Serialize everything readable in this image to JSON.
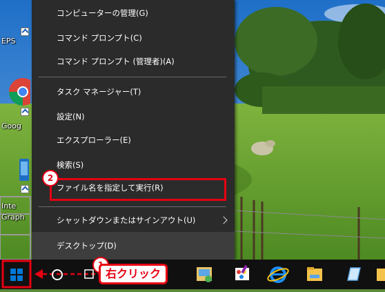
{
  "desktop": {
    "icons": [
      {
        "label": "EPS",
        "icon": "epson-icon"
      },
      {
        "label": "Goog",
        "icon": "google-chrome-icon"
      },
      {
        "label": "Inte",
        "label2": "Graph",
        "icon": "intel-graphics-icon"
      }
    ]
  },
  "menu": {
    "items": [
      {
        "label": "コンピューターの管理(G)"
      },
      {
        "label": "コマンド プロンプト(C)"
      },
      {
        "label": "コマンド プロンプト (管理者)(A)"
      },
      {
        "label": "タスク マネージャー(T)"
      },
      {
        "label": "設定(N)"
      },
      {
        "label": "エクスプローラー(E)"
      },
      {
        "label": "検索(S)"
      },
      {
        "label": "ファイル名を指定して実行(R)"
      },
      {
        "label": "シャットダウンまたはサインアウト(U)"
      },
      {
        "label": "デスクトップ(D)"
      }
    ]
  },
  "annotations": {
    "step1_number": "1",
    "step1_text": "右クリック",
    "step2_number": "2"
  },
  "taskbar": {
    "icons": [
      "windows-start-icon",
      "cortana-search-icon",
      "task-view-icon",
      "control-panel-icon",
      "paint-icon",
      "internet-explorer-icon",
      "file-explorer-icon",
      "notes-icon",
      "app-icon"
    ]
  },
  "colors": {
    "menu_bg": "#2b2b2b",
    "taskbar_bg": "#101010",
    "annotation_red": "#e60012",
    "start_blue": "#0078d7"
  }
}
